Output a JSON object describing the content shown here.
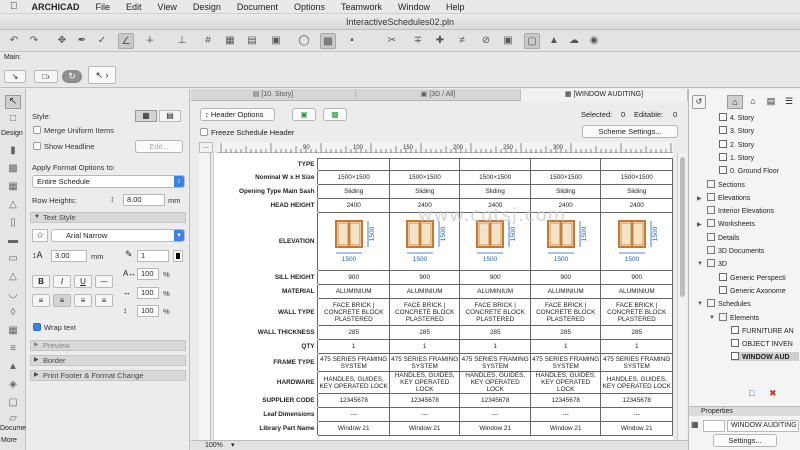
{
  "menubar": {
    "app": "ARCHICAD",
    "items": [
      "File",
      "Edit",
      "View",
      "Design",
      "Document",
      "Options",
      "Teamwork",
      "Window",
      "Help"
    ]
  },
  "window": {
    "title": "InteractiveSchedules02.pln"
  },
  "infobox": {
    "label": "Main:"
  },
  "toolbox": {
    "design_label": "Design",
    "document_label": "Docume",
    "more_label": "More"
  },
  "leftpanel": {
    "style_label": "Style:",
    "merge_uniform_items": "Merge Uniform Items",
    "show_headline": "Show Headline",
    "edit_button": "Edit...",
    "apply_format_label": "Apply Format Options to:",
    "apply_format_value": "Entire Schedule",
    "row_heights_label": "Row Heights:",
    "row_heights_value": "8.00",
    "row_heights_unit": "mm",
    "text_style_section": "Text Style",
    "font_value": "Arial Narrow",
    "font_size_value": "3.00",
    "font_size_unit": "mm",
    "pen_value": "1",
    "width_factor": "100",
    "spacing_factor": "100",
    "angle_factor": "100",
    "percent": "%",
    "bold_label": "B",
    "italic_label": "I",
    "underline_label": "U",
    "wrap_text_label": "Wrap text",
    "preview_section": "Preview",
    "border_section": "Border",
    "print_footer_section": "Print Footer & Format Change"
  },
  "tabs": [
    {
      "label": "[10. Story]"
    },
    {
      "label": "[3D / All]"
    },
    {
      "label": "[WINDOW AUDITING]"
    }
  ],
  "schedbar": {
    "header_options": "Header Options",
    "selected_label": "Selected:",
    "selected_value": "0",
    "editable_label": "Editable:",
    "editable_value": "0",
    "freeze_header": "Freeze Schedule Header",
    "scheme_settings": "Scheme Settings..."
  },
  "ruler": {
    "labels": [
      "50",
      "90",
      "100",
      "150",
      "200",
      "250",
      "300"
    ]
  },
  "schedule": {
    "rows": [
      {
        "header": "TYPE",
        "cells": [
          "",
          "",
          "",
          "",
          ""
        ],
        "h": 12
      },
      {
        "header": "Nominal W x H Size",
        "cells": [
          "1500×1500",
          "1500×1500",
          "1500×1500",
          "1500×1500",
          "1500×1500"
        ],
        "h": 14
      },
      {
        "header": "Opening Type Main Sash",
        "cells": [
          "Sliding",
          "Sliding",
          "Sliding",
          "Sliding",
          "Sliding"
        ],
        "h": 14
      },
      {
        "header": "HEAD HEIGHT",
        "cells": [
          "2400",
          "2400",
          "2400",
          "2400",
          "2400"
        ],
        "h": 14
      },
      {
        "header": "ELEVATION",
        "cells": [
          "",
          "",
          "",
          "",
          ""
        ],
        "h": 58,
        "elevation": true
      },
      {
        "header": "SILL HEIGHT",
        "cells": [
          "900",
          "900",
          "900",
          "900",
          "900"
        ],
        "h": 14
      },
      {
        "header": "MATERIAL",
        "cells": [
          "ALUMINIUM",
          "ALUMINIUM",
          "ALUMINIUM",
          "ALUMINIUM",
          "ALUMINIUM"
        ],
        "h": 14
      },
      {
        "header": "WALL TYPE",
        "cells": [
          "FACE BRICK | CONCRETE BLOCK PLASTERED",
          "FACE BRICK | CONCRETE BLOCK PLASTERED",
          "FACE BRICK | CONCRETE BLOCK PLASTERED",
          "FACE BRICK | CONCRETE BLOCK PLASTERED",
          "FACE BRICK | CONCRETE BLOCK PLASTERED"
        ],
        "h": 27
      },
      {
        "header": "WALL THICKNESS",
        "cells": [
          "285",
          "285",
          "285",
          "285",
          "285"
        ],
        "h": 14
      },
      {
        "header": "QTY",
        "cells": [
          "1",
          "1",
          "1",
          "1",
          "1"
        ],
        "h": 14
      },
      {
        "header": "FRAME TYPE",
        "cells": [
          "475 SERIES FRAMING SYSTEM",
          "475 SERIES FRAMING SYSTEM",
          "475 SERIES FRAMING SYSTEM",
          "475 SERIES FRAMING SYSTEM",
          "475 SERIES FRAMING SYSTEM"
        ],
        "h": 18
      },
      {
        "header": "HARDWARE",
        "cells": [
          "HANDLES, GUIDES, KEY OPERATED LOCK",
          "HANDLES, GUIDES, KEY OPERATED LOCK",
          "HANDLES, GUIDES, KEY OPERATED LOCK",
          "HANDLES, GUIDES, KEY OPERATED LOCK",
          "HANDLES, GUIDES, KEY OPERATED LOCK"
        ],
        "h": 18
      },
      {
        "header": "SUPPLIER CODE",
        "cells": [
          "12345678",
          "12345678",
          "12345678",
          "12345678",
          "12345678"
        ],
        "h": 14
      },
      {
        "header": "Leaf Dimensions",
        "cells": [
          "---",
          "---",
          "---",
          "---",
          "---"
        ],
        "h": 14
      },
      {
        "header": "Library Part Name",
        "cells": [
          "Window 21",
          "Window 21",
          "Window 21",
          "Window 21",
          "Window 21"
        ],
        "h": 14
      }
    ],
    "elevation_width_label": "1500",
    "elevation_height_label": "1500"
  },
  "statusbar": {
    "zoom": "100%"
  },
  "navigator": {
    "items": [
      {
        "label": "4. Story",
        "kind": "story"
      },
      {
        "label": "3. Story",
        "kind": "story"
      },
      {
        "label": "2. Story",
        "kind": "story"
      },
      {
        "label": "1. Story",
        "kind": "story"
      },
      {
        "label": "0. Ground Floor",
        "kind": "story"
      },
      {
        "label": "Sections",
        "kind": "folder"
      },
      {
        "label": "Elevations",
        "kind": "folder"
      },
      {
        "label": "Interior Elevations",
        "kind": "folder"
      },
      {
        "label": "Worksheets",
        "kind": "folder"
      },
      {
        "label": "Details",
        "kind": "folder"
      },
      {
        "label": "3D Documents",
        "kind": "folder"
      },
      {
        "label": "3D",
        "kind": "folder"
      },
      {
        "label": "Generic Perspecti",
        "kind": "view"
      },
      {
        "label": "Generic Axonome",
        "kind": "view"
      },
      {
        "label": "Schedules",
        "kind": "folder"
      },
      {
        "label": "Elements",
        "kind": "folder"
      },
      {
        "label": "FURNITURE AN",
        "kind": "schedule"
      },
      {
        "label": "OBJECT INVEN",
        "kind": "schedule"
      },
      {
        "label": "WINDOW AUD",
        "kind": "schedule"
      }
    ],
    "properties_label": "Properties",
    "properties_value": "WINDOW AUDITING",
    "settings_button": "Settings..."
  },
  "watermark": "www.cgtsj.com",
  "colors": {
    "accent": "#3b82e6",
    "window_frame": "#c8762b",
    "dim_color": "#1f5fbf"
  }
}
